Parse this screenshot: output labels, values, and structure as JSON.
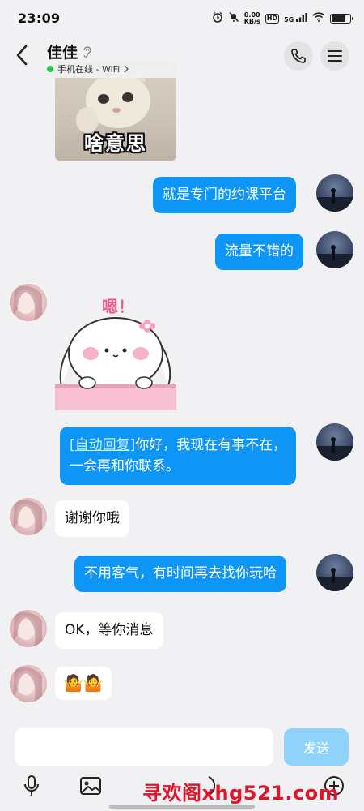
{
  "status_bar": {
    "time": "23:09",
    "net_speed_value": "0.00",
    "net_speed_unit": "KB/s",
    "hd": "HD",
    "signal": "5G",
    "battery_level": 0.85
  },
  "header": {
    "contact_name": "佳佳",
    "online_status": "手机在线 - WiFi",
    "status_color": "#27c94a"
  },
  "messages": [
    {
      "type": "sticker",
      "side": "in",
      "caption": "啥意思"
    },
    {
      "type": "text",
      "side": "out",
      "text": "就是专门的约课平台"
    },
    {
      "type": "text",
      "side": "out",
      "text": "流量不错的"
    },
    {
      "type": "sticker",
      "side": "in",
      "caption": "嗯！"
    },
    {
      "type": "text",
      "side": "out",
      "auto_tag": "[自动回复]",
      "line1": "你好，我现在有事不在，",
      "line2": "一会再和你联系。"
    },
    {
      "type": "text",
      "side": "in",
      "text": "谢谢你哦"
    },
    {
      "type": "text",
      "side": "out",
      "text": "不用客气，有时间再去找你玩哈"
    },
    {
      "type": "text",
      "side": "in",
      "text": "OK，等你消息"
    },
    {
      "type": "emoji",
      "side": "in",
      "emoji": "🤷🤷"
    }
  ],
  "input": {
    "value": "",
    "send_label": "发送"
  },
  "toolbar": [
    "voice-icon",
    "image-icon",
    "camera-icon",
    "emoji-icon",
    "plus-icon"
  ],
  "watermark": "寻欢阁xhg521.com",
  "colors": {
    "outgoing_bubble": "#0e96f7",
    "incoming_bubble": "#ffffff",
    "send_button": "#8fd3fb",
    "background": "#f1f1f3"
  }
}
